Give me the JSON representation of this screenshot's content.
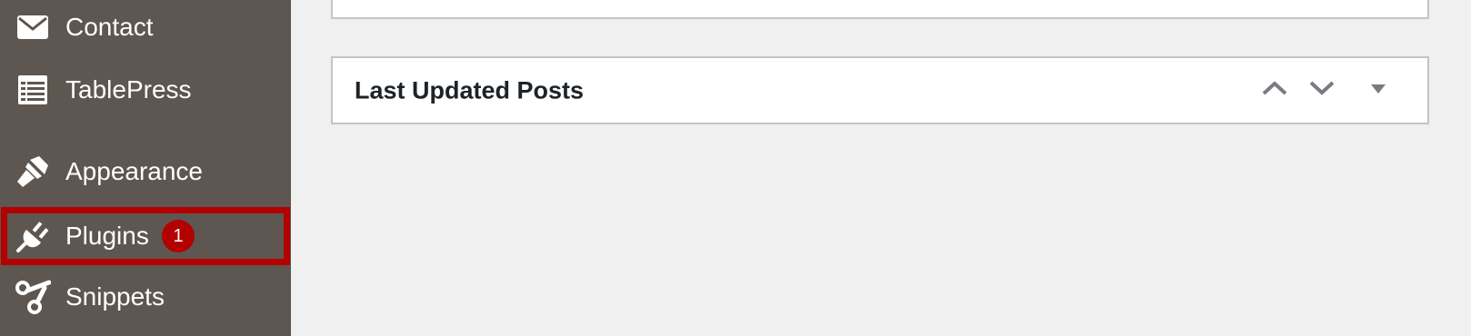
{
  "sidebar": {
    "items": [
      {
        "label": "Contact",
        "icon": "mail-icon"
      },
      {
        "label": "TablePress",
        "icon": "table-icon"
      },
      {
        "label": "Appearance",
        "icon": "paintbrush-icon"
      },
      {
        "label": "Plugins",
        "icon": "plugin-icon",
        "badge": "1",
        "highlighted": true
      },
      {
        "label": "Snippets",
        "icon": "scissors-icon"
      }
    ]
  },
  "main": {
    "postbox": {
      "title": "Last Updated Posts",
      "controls": [
        "move-up",
        "move-down",
        "toggle-panel"
      ]
    }
  },
  "colors": {
    "sidebar_bg": "#5e5650",
    "highlight": "#b30000",
    "page_bg": "#f0f0f1",
    "panel_border": "#c3c4c7"
  }
}
